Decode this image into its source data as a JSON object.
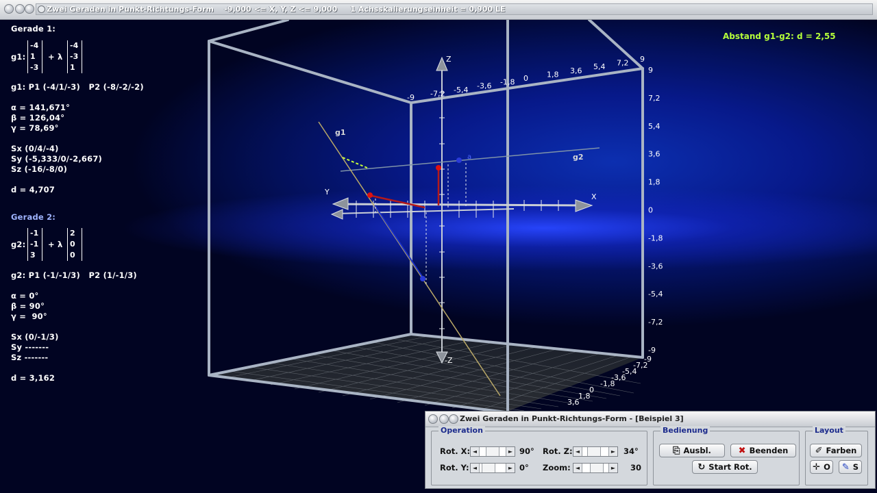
{
  "window": {
    "title": "Zwei Geraden in Punkt-Richtungs-Form    -9,000 <= X, Y, Z <= 9,000     1 Achsskalierungseinheit = 0,900 LE"
  },
  "info": {
    "g1_heading": "Gerade 1:",
    "g1_label": "g1:",
    "g1_point": [
      "-4",
      "1",
      "-3"
    ],
    "g1_dir": [
      "-4",
      "-3",
      "1"
    ],
    "plus_lambda": "+ λ",
    "g1_points": "g1: P1 (-4/1/-3)   P2 (-8/-2/-2)",
    "g1_alpha": "α = 141,671°",
    "g1_beta": "β = 126,04°",
    "g1_gamma": "γ = 78,69°",
    "g1_sx": "Sx (0/4/-4)",
    "g1_sy": "Sy (-5,333/0/-2,667)",
    "g1_sz": "Sz (-16/-8/0)",
    "g1_d": "d = 4,707",
    "g2_heading": "Gerade 2:",
    "g2_label": "g2:",
    "g2_point": [
      "-1",
      "-1",
      "3"
    ],
    "g2_dir": [
      "2",
      "0",
      "0"
    ],
    "g2_points": "g2: P1 (-1/-1/3)   P2 (1/-1/3)",
    "g2_alpha": "α = 0°",
    "g2_beta": "β = 90°",
    "g2_gamma": "γ =  90°",
    "g2_sx": "Sx (0/-1/3)",
    "g2_sy": "Sy -------",
    "g2_sz": "Sz -------",
    "g2_d": "d = 3,162"
  },
  "distance": "Abstand g1-g2: d = 2,55",
  "plot": {
    "axis_x": "X",
    "axis_y": "Y",
    "axis_z": "Z",
    "axis_neg_z": "-Z",
    "line_g1": "g1",
    "line_g2": "g2",
    "point_a": "a",
    "right_ticks": [
      "9",
      "7,2",
      "5,4",
      "3,6",
      "1,8",
      "0",
      "-1,8",
      "-3,6",
      "-5,4",
      "-7,2",
      "-9"
    ],
    "top_ticks": [
      "-9",
      "-7,2",
      "-5,4",
      "-3,6",
      "-1,8",
      "0",
      "1,8",
      "3,6",
      "5,4",
      "7,2",
      "9"
    ],
    "bottom_ticks": [
      "-9",
      "-7,2",
      "-5,4",
      "-3,6",
      "-1,8",
      "0",
      "1,8",
      "3,6"
    ]
  },
  "dialog": {
    "title": "Zwei Geraden in Punkt-Richtungs-Form - [Beispiel 3]",
    "operation_label": "Operation",
    "rot_x_label": "Rot. X:",
    "rot_x_value": "90°",
    "rot_y_label": "Rot. Y:",
    "rot_y_value": "0°",
    "rot_z_label": "Rot. Z:",
    "rot_z_value": "34°",
    "zoom_label": "Zoom:",
    "zoom_value": "30",
    "bedienung_label": "Bedienung",
    "ausbl_label": "Ausbl.",
    "beenden_label": "Beenden",
    "start_rot_label": "Start Rot.",
    "layout_label": "Layout",
    "farben_label": "Farben",
    "o_label": "O",
    "s_label": "S"
  }
}
